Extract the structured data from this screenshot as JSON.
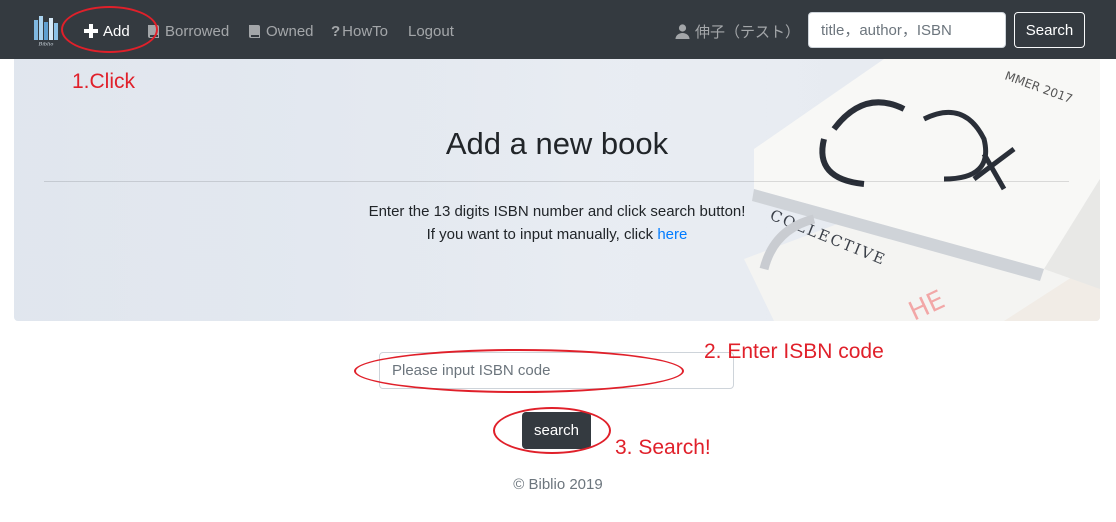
{
  "nav": {
    "brand_logo_text": "Biblio",
    "add_label": "Add",
    "borrowed_label": "Borrowed",
    "owned_label": "Owned",
    "howto_label": "HowTo",
    "logout_label": "Logout",
    "user_label": "伸子（テスト）",
    "search_placeholder": "title，author，ISBN",
    "search_button": "Search"
  },
  "hero": {
    "title": "Add a new book",
    "line1": "Enter the 13 digits ISBN number and click search button!",
    "line2_prefix": "If you want to input manually, click ",
    "line2_link": "here"
  },
  "form": {
    "isbn_placeholder": "Please input ISBN code",
    "search_button": "search"
  },
  "footer": {
    "text": "© Biblio 2019"
  },
  "annotations": {
    "step1": "1.Click",
    "step2": "2. Enter ISBN code",
    "step3": "3. Search!"
  },
  "colors": {
    "navbar_bg": "#343a40",
    "annotation_red": "#e0202a",
    "link_blue": "#007bff",
    "button_dark": "#343a40"
  },
  "icons": {
    "add": "plus-icon",
    "borrowed": "book-icon",
    "owned": "book-icon",
    "howto": "question-icon",
    "user": "user-icon"
  }
}
